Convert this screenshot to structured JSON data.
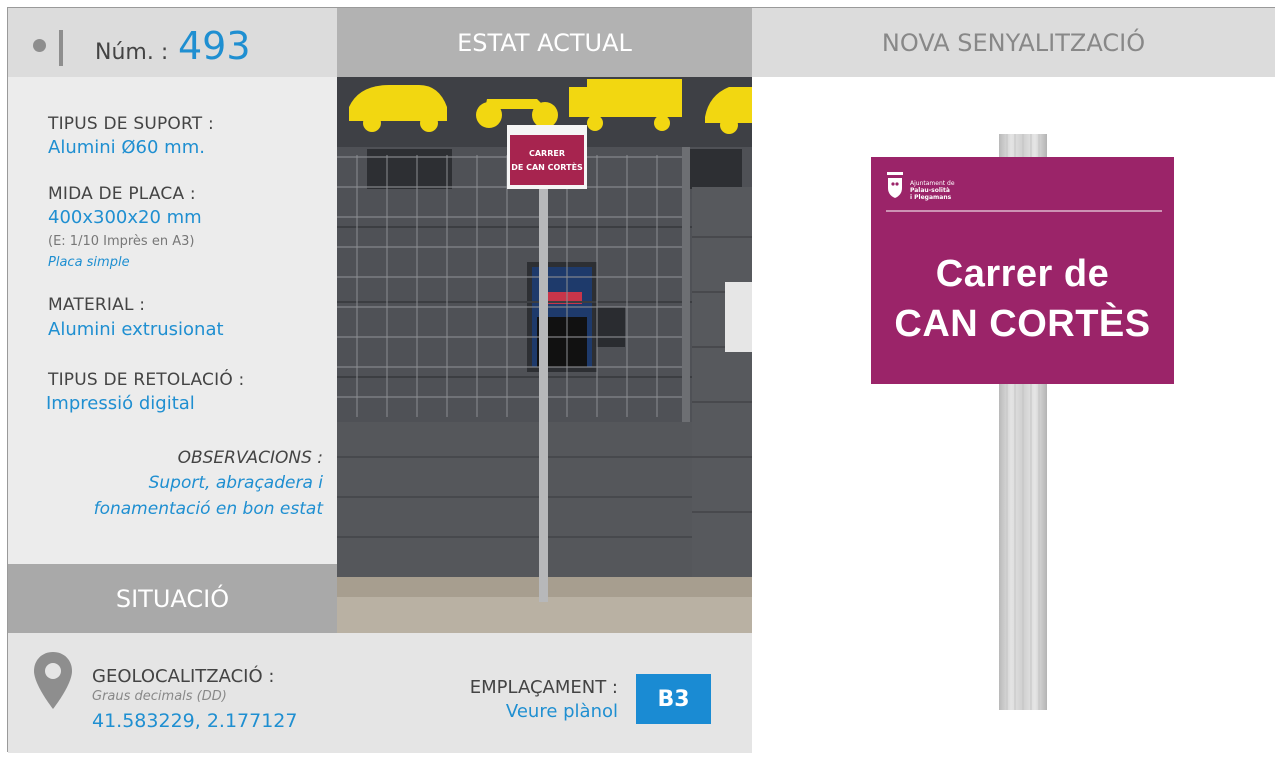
{
  "header": {
    "num_label": "Núm. :",
    "num_value": "493",
    "estat_actual": "ESTAT ACTUAL",
    "nova_senyalitzacio": "NOVA SENYALITZACIÓ"
  },
  "info": {
    "suport_label": "TIPUS DE SUPORT :",
    "suport_value": "Alumini Ø60 mm.",
    "mida_label": "MIDA DE PLACA :",
    "mida_value": "400x300x20 mm",
    "mida_escala": "(E: 1/10 Imprès en A3)",
    "mida_tipus": "Placa simple",
    "material_label": "MATERIAL :",
    "material_value": "Alumini extrusionat",
    "retolacio_label": "TIPUS DE RETOLACIÓ :",
    "retolacio_value": "Impressió digital",
    "observacions_label": "OBSERVACIONS :",
    "observacions_line1": "Suport, abraçadera i",
    "observacions_line2": "fonamentació en bon estat"
  },
  "situacio": {
    "title": "SITUACIÓ",
    "geo_label": "GEOLOCALITZACIÓ :",
    "geo_format": "Graus decimals (DD)",
    "geo_value": "41.583229, 2.177127",
    "emplacament_label": "EMPLAÇAMENT :",
    "emplacament_link": "Veure plànol",
    "emplacament_code": "B3"
  },
  "photo_sign": {
    "line1": "CARRER",
    "line2": "DE CAN CORTÈS"
  },
  "new_sign": {
    "org_line1": "Ajuntament de",
    "org_line2": "Palau-solità",
    "org_line3": "i Plegamans",
    "title_line1": "Carrer de",
    "title_line2": "CAN CORTÈS"
  },
  "colors": {
    "accent_blue": "#1f8fd1",
    "sign_magenta": "#9b2469",
    "header_grey": "#dcdcdc"
  }
}
